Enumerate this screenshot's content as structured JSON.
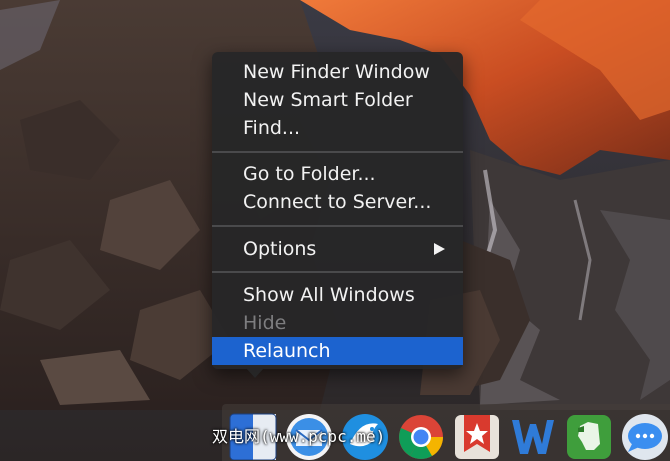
{
  "menu": {
    "groups": [
      [
        {
          "label": "New Finder Window"
        },
        {
          "label": "New Smart Folder"
        },
        {
          "label": "Find..."
        }
      ],
      [
        {
          "label": "Go to Folder..."
        },
        {
          "label": "Connect to Server..."
        }
      ],
      [
        {
          "label": "Options",
          "submenu": true
        }
      ],
      [
        {
          "label": "Show All Windows"
        },
        {
          "label": "Hide",
          "disabled": true
        },
        {
          "label": "Relaunch",
          "selected": true
        }
      ]
    ]
  },
  "dock": {
    "items": [
      {
        "name": "finder-icon"
      },
      {
        "name": "mail-icon"
      },
      {
        "name": "bird-icon"
      },
      {
        "name": "chrome-icon"
      },
      {
        "name": "wunderlist-icon"
      },
      {
        "name": "word-icon"
      },
      {
        "name": "evernote-icon"
      },
      {
        "name": "messages-icon"
      }
    ]
  },
  "watermark": {
    "text": "双电网(www.pcpc.me)"
  },
  "colors": {
    "menu_bg": "#262628",
    "highlight": "#1c63cf",
    "text": "#f2f2f2",
    "disabled_text": "#7d7d7f",
    "separator": "#4a4a4c"
  }
}
